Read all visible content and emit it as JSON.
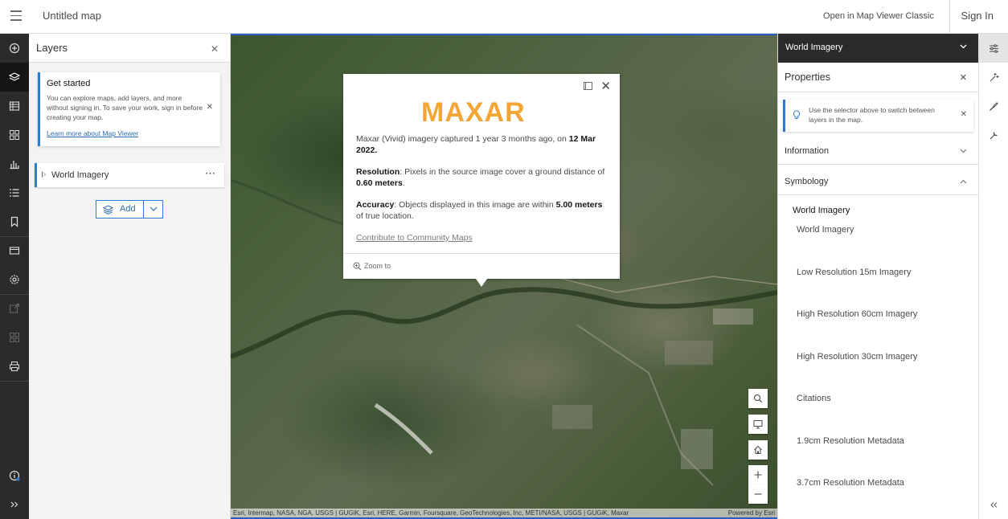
{
  "header": {
    "app_title": "Untitled map",
    "classic_link": "Open in Map Viewer Classic",
    "sign_in": "Sign In"
  },
  "left_rail": {
    "items": [
      "add-icon",
      "layers-icon",
      "table-icon",
      "basemap-icon",
      "charts-icon",
      "legend-icon",
      "bookmarks-icon",
      "map-properties-icon",
      "settings-icon",
      "share-icon",
      "create-app-icon",
      "print-icon",
      "info-icon",
      "expand-icon"
    ]
  },
  "layers_panel": {
    "title": "Layers",
    "notice": {
      "title": "Get started",
      "text": "You can explore maps, add layers, and more without signing in. To save your work, sign in before creating your map.",
      "link": "Learn more about Map Viewer"
    },
    "layer": {
      "name": "World Imagery",
      "more": "⋯"
    },
    "add_button": "Add"
  },
  "popup": {
    "logo": "MAXAR",
    "capture_prefix": "Maxar (Vivid) imagery captured 1 year 3 months ago, on ",
    "capture_date": "12 Mar 2022.",
    "resolution_label": "Resolution",
    "resolution_text": ": Pixels in the source image cover a ground distance of ",
    "resolution_value": "0.60 meters",
    "resolution_end": ".",
    "accuracy_label": "Accuracy",
    "accuracy_text": ": Objects displayed in this image are within ",
    "accuracy_value": "5.00 meters",
    "accuracy_end": " of true location.",
    "contribute_link": "Contribute to Community Maps",
    "zoom_to": "Zoom to"
  },
  "map": {
    "attribution": "Esri, Intermap, NASA, NGA, USGS | GUGiK, Esri, HERE, Garmin, Foursquare, GeoTechnologies, Inc, METI/NASA, USGS | GUGiK, Maxar",
    "powered_by": "Powered by Esri",
    "tools": [
      "search-icon",
      "monitor-icon",
      "home-icon",
      "zoom-in-icon",
      "zoom-out-icon"
    ]
  },
  "properties": {
    "layer_selector": "World Imagery",
    "title": "Properties",
    "notice": "Use the selector above to switch between layers in the map.",
    "sections": [
      "Information",
      "Symbology"
    ],
    "symbology_title": "World Imagery",
    "symbology_items": [
      "World Imagery",
      "Low Resolution 15m Imagery",
      "High Resolution 60cm Imagery",
      "High Resolution 30cm Imagery",
      "Citations",
      "1.9cm Resolution Metadata",
      "3.7cm Resolution Metadata"
    ]
  },
  "right_rail": {
    "items": [
      "properties-icon",
      "effects-icon",
      "styles-icon",
      "configure-icon",
      "collapse-icon"
    ]
  }
}
